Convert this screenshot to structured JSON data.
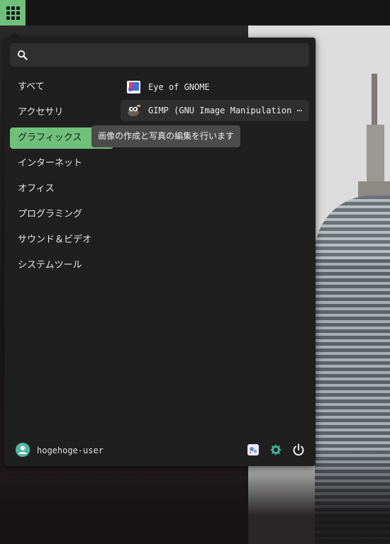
{
  "panel": {
    "apps_icon": "grid-icon"
  },
  "menu": {
    "search": {
      "placeholder": "",
      "icon": "search-icon"
    },
    "categories": [
      {
        "label": "すべて",
        "active": false
      },
      {
        "label": "アクセサリ",
        "active": false
      },
      {
        "label": "グラフィックス",
        "active": true
      },
      {
        "label": "インターネット",
        "active": false
      },
      {
        "label": "オフィス",
        "active": false
      },
      {
        "label": "プログラミング",
        "active": false
      },
      {
        "label": "サウンド＆ビデオ",
        "active": false
      },
      {
        "label": "システムツール",
        "active": false
      }
    ],
    "apps": [
      {
        "label": "Eye of GNOME",
        "icon": "eog-icon"
      },
      {
        "label": "GIMP (GNU Image Manipulation ⋯",
        "icon": "gimp-icon"
      }
    ],
    "tooltip": "画像の作成と写真の編集を行います",
    "user": {
      "name": "hogehoge-user",
      "icon": "avatar-icon"
    },
    "actions": [
      {
        "name": "settings-app-icon"
      },
      {
        "name": "extension-icon"
      },
      {
        "name": "power-icon"
      }
    ],
    "accent_color": "#6fc07b"
  }
}
